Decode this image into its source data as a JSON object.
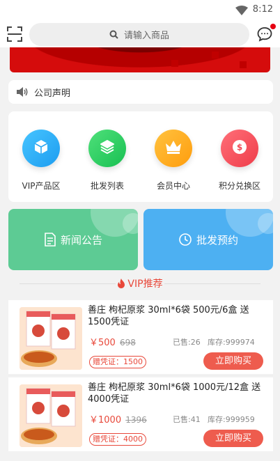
{
  "status_bar": {
    "time": "8:12"
  },
  "search": {
    "placeholder": "请输入商品"
  },
  "notice": {
    "text": "公司声明"
  },
  "menu": [
    {
      "label": "VIP产品区",
      "icon": "cube-icon",
      "color": "#22a9f5"
    },
    {
      "label": "批发列表",
      "icon": "layers-icon",
      "color": "#22c95a"
    },
    {
      "label": "会员中心",
      "icon": "crown-icon",
      "color": "#ffad1f"
    },
    {
      "label": "积分兑换区",
      "icon": "coin-icon",
      "color": "#f5505c"
    }
  ],
  "features": [
    {
      "label": "新闻公告",
      "icon": "document-icon",
      "color": "#5dcb94"
    },
    {
      "label": "批发预约",
      "icon": "clock-icon",
      "color": "#4db0f2"
    }
  ],
  "section": {
    "title": "VIP推荐"
  },
  "products": [
    {
      "name": "善庄 枸杞原浆 30ml*6袋 500元/6盒 送1500凭证",
      "price": "￥500",
      "price_old": "698",
      "sold": "已售:26",
      "stock": "库存:999974",
      "voucher": "赠凭证：1500",
      "buy_label": "立即购买"
    },
    {
      "name": "善庄 枸杞原浆 30ml*6袋 1000元/12盒 送4000凭证",
      "price": "￥1000",
      "price_old": "1396",
      "sold": "已售:41",
      "stock": "库存:999959",
      "voucher": "赠凭证：4000",
      "buy_label": "立即购买"
    }
  ],
  "colors": {
    "accent": "#e8483a",
    "buy_button": "#ee5c4e",
    "badge": "#e60012"
  }
}
